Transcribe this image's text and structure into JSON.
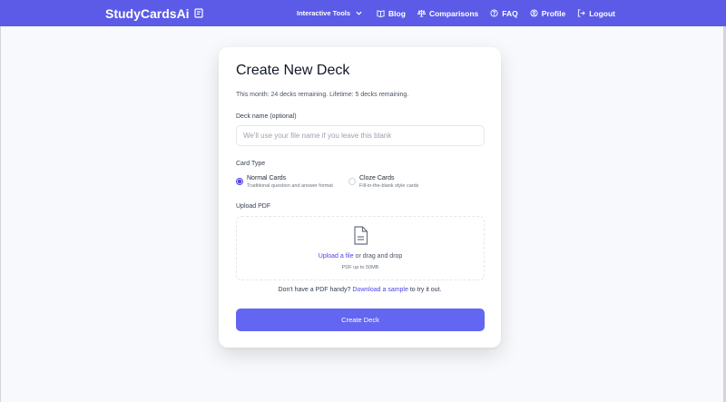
{
  "navbar": {
    "brand": "StudyCardsAi",
    "items": [
      {
        "label": "Interactive Tools",
        "icon": "chevron-down-icon"
      },
      {
        "label": "Blog",
        "icon": "book-icon"
      },
      {
        "label": "Comparisons",
        "icon": "scale-icon"
      },
      {
        "label": "FAQ",
        "icon": "question-circle-icon"
      },
      {
        "label": "Profile",
        "icon": "user-circle-icon"
      },
      {
        "label": "Logout",
        "icon": "logout-icon"
      }
    ],
    "color": "#5b5be8"
  },
  "form": {
    "title": "Create New Deck",
    "quota_text": "This month: 24 decks remaining. Lifetime: 5 decks remaining.",
    "deck_name": {
      "label": "Deck name (optional)",
      "value": "",
      "placeholder": "We'll use your file name if you leave this blank"
    },
    "card_type": {
      "label": "Card Type",
      "options": [
        {
          "title": "Normal Cards",
          "description": "Traditional question and answer format",
          "selected": true
        },
        {
          "title": "Cloze Cards",
          "description": "Fill-in-the-blank style cards",
          "selected": false
        }
      ]
    },
    "upload": {
      "label": "Upload PDF",
      "link_text": "Upload a file",
      "rest_text": " or drag and drop",
      "hint": "PDF up to 50MB"
    },
    "sample": {
      "prefix": "Don't have a PDF handy? ",
      "link_text": "Download a sample",
      "suffix": " to try it out."
    },
    "submit_label": "Create Deck",
    "accent_color": "#6366f1"
  }
}
